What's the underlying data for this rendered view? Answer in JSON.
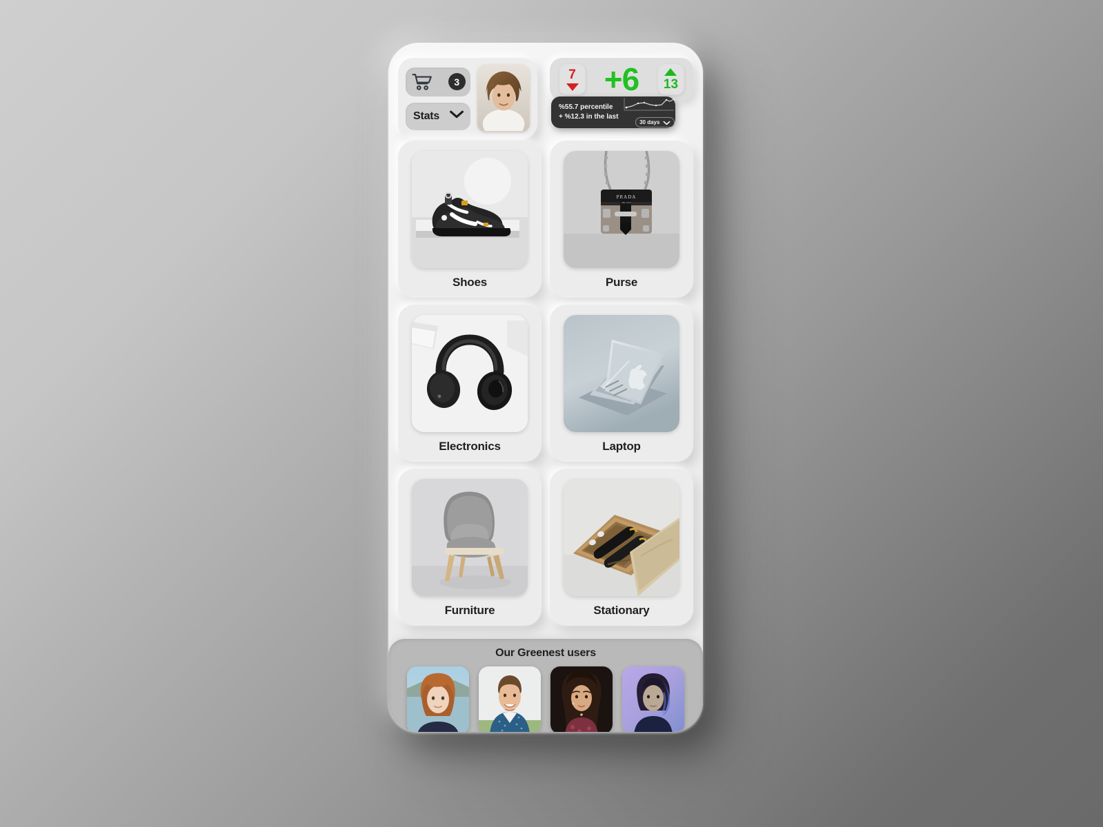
{
  "app": {
    "background_start": "#cfcfcf",
    "background_end": "#6a6a6a",
    "surface": "#efefef"
  },
  "topbar": {
    "cart": {
      "icon": "shopping-cart-icon",
      "badge_count": "3"
    },
    "stats_button": {
      "label": "Stats",
      "icon": "chevron-down-icon"
    },
    "profile_avatar": {
      "alt": "user-profile-photo"
    }
  },
  "stats": {
    "down_metric": {
      "value": "7",
      "direction": "down",
      "color": "#d42020"
    },
    "main_metric": {
      "value": "+6",
      "color": "#22c022"
    },
    "up_metric": {
      "value": "13",
      "direction": "up",
      "color": "#1db81d"
    },
    "detail_card": {
      "percentile_line": "%55.7 percentile",
      "change_line": "+ %12.3 in the last",
      "range_selector": {
        "value": "30 days",
        "icon": "chevron-down-icon"
      },
      "sparkline": {
        "points": [
          3,
          5,
          8,
          9,
          7,
          6,
          7,
          12,
          10,
          13
        ]
      }
    }
  },
  "products": [
    {
      "label": "Shoes",
      "image": "black-sneaker-photo"
    },
    {
      "label": "Purse",
      "image": "black-chain-purse-photo"
    },
    {
      "label": "Electronics",
      "image": "black-headphones-photo"
    },
    {
      "label": "Laptop",
      "image": "silver-laptop-photo"
    },
    {
      "label": "Furniture",
      "image": "gray-upholstered-chair-photo"
    },
    {
      "label": "Stationary",
      "image": "fountain-pens-wood-case-photo"
    }
  ],
  "users_section": {
    "title": "Our Greenest users",
    "users": [
      {
        "alt": "user-avatar-1"
      },
      {
        "alt": "user-avatar-2"
      },
      {
        "alt": "user-avatar-3"
      },
      {
        "alt": "user-avatar-4"
      }
    ]
  }
}
